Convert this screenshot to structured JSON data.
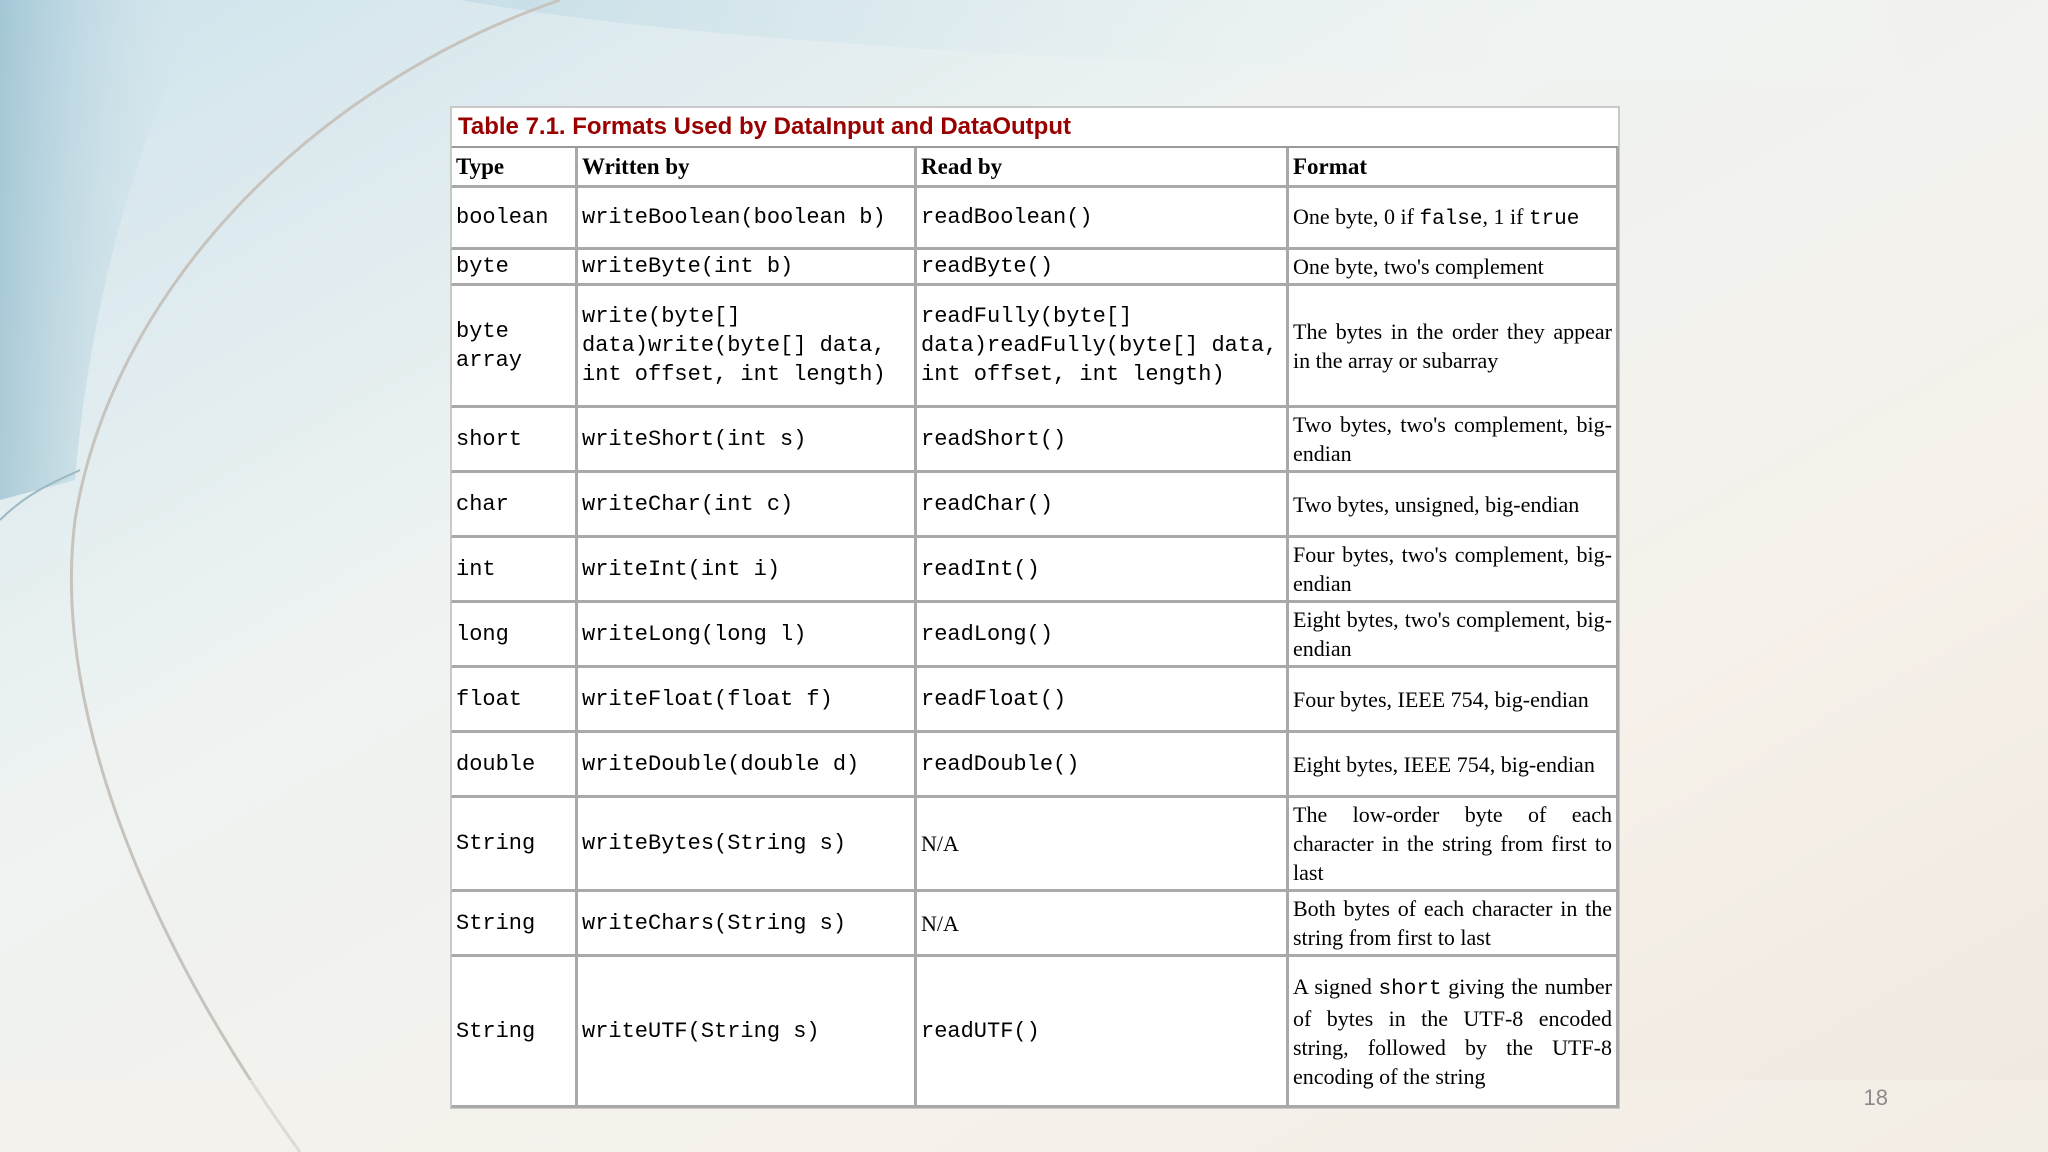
{
  "caption": "Table 7.1. Formats Used by DataInput and DataOutput",
  "headers": {
    "type": "Type",
    "written_by": "Written by",
    "read_by": "Read by",
    "format": "Format"
  },
  "rows": [
    {
      "type": "boolean",
      "written": "writeBoolean(boolean b)",
      "read": "readBoolean()",
      "format_pre": "One byte, 0 if ",
      "format_code": "false",
      "format_mid": ", 1 if ",
      "format_code2": "true",
      "format_post": ""
    },
    {
      "type": "byte",
      "written": "writeByte(int b)",
      "read": "readByte()",
      "format_pre": "One byte, two's complement",
      "format_code": "",
      "format_mid": "",
      "format_code2": "",
      "format_post": ""
    },
    {
      "type": "byte array",
      "written": "write(byte[] data)write(byte[] data, int offset, int length)",
      "read": "readFully(byte[] data)readFully(byte[] data, int offset, int length)",
      "format_pre": "The bytes in the order they appear in the array or subarray",
      "format_code": "",
      "format_mid": "",
      "format_code2": "",
      "format_post": ""
    },
    {
      "type": "short",
      "written": "writeShort(int s)",
      "read": "readShort()",
      "format_pre": "Two bytes, two's complement, big- endian",
      "format_code": "",
      "format_mid": "",
      "format_code2": "",
      "format_post": ""
    },
    {
      "type": "char",
      "written": "writeChar(int c)",
      "read": "readChar()",
      "format_pre": "Two bytes, unsigned, big-endian",
      "format_code": "",
      "format_mid": "",
      "format_code2": "",
      "format_post": ""
    },
    {
      "type": "int",
      "written": "writeInt(int i)",
      "read": "readInt()",
      "format_pre": "Four bytes, two's complement, big-endian",
      "format_code": "",
      "format_mid": "",
      "format_code2": "",
      "format_post": ""
    },
    {
      "type": "long",
      "written": "writeLong(long l)",
      "read": "readLong()",
      "format_pre": "Eight bytes, two's complement, big-endian",
      "format_code": "",
      "format_mid": "",
      "format_code2": "",
      "format_post": ""
    },
    {
      "type": "float",
      "written": "writeFloat(float f)",
      "read": "readFloat()",
      "format_pre": "Four bytes, IEEE 754, big-endian",
      "format_code": "",
      "format_mid": "",
      "format_code2": "",
      "format_post": ""
    },
    {
      "type": "double",
      "written": "writeDouble(double d)",
      "read": "readDouble()",
      "format_pre": "Eight bytes, IEEE 754, big-endian",
      "format_code": "",
      "format_mid": "",
      "format_code2": "",
      "format_post": ""
    },
    {
      "type": "String",
      "written": "writeBytes(String s)",
      "read": "N/A",
      "format_pre": "The low-order byte of each character in the string from first to last",
      "format_code": "",
      "format_mid": "",
      "format_code2": "",
      "format_post": ""
    },
    {
      "type": "String",
      "written": "writeChars(String s)",
      "read": "N/A",
      "format_pre": "Both bytes of each character in the string from first to last",
      "format_code": "",
      "format_mid": "",
      "format_code2": "",
      "format_post": ""
    },
    {
      "type": "String",
      "written": "writeUTF(String s)",
      "read": "readUTF()",
      "format_pre": "A signed ",
      "format_code": "short",
      "format_mid": " giving the number of bytes in the UTF-8 encoded string, followed by the UTF-8 encoding of the string",
      "format_code2": "",
      "format_post": ""
    }
  ],
  "page_number": "18",
  "colors": {
    "caption": "#990000",
    "code": "#e21a1a",
    "border": "#a9a9a9"
  }
}
